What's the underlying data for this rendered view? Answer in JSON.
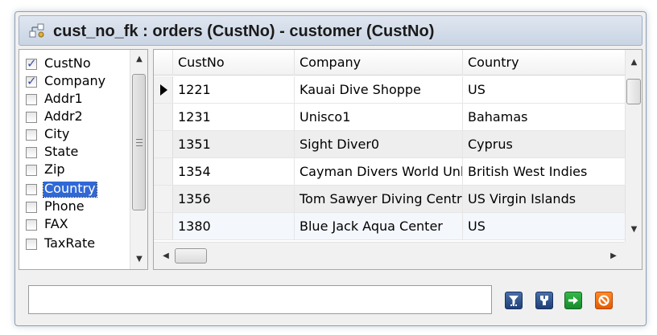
{
  "window": {
    "title": "cust_no_fk : orders (CustNo) - customer (CustNo)"
  },
  "fields": [
    {
      "label": "CustNo",
      "checked": true,
      "selected": false
    },
    {
      "label": "Company",
      "checked": true,
      "selected": false
    },
    {
      "label": "Addr1",
      "checked": false,
      "selected": false
    },
    {
      "label": "Addr2",
      "checked": false,
      "selected": false
    },
    {
      "label": "City",
      "checked": false,
      "selected": false
    },
    {
      "label": "State",
      "checked": false,
      "selected": false
    },
    {
      "label": "Zip",
      "checked": false,
      "selected": false
    },
    {
      "label": "Country",
      "checked": false,
      "selected": true
    },
    {
      "label": "Phone",
      "checked": false,
      "selected": false
    },
    {
      "label": "FAX",
      "checked": false,
      "selected": false
    },
    {
      "label": "TaxRate",
      "checked": false,
      "selected": false
    }
  ],
  "grid": {
    "columns": [
      "CustNo",
      "Company",
      "Country"
    ],
    "rows": [
      {
        "CustNo": "1221",
        "Company": "Kauai Dive Shoppe",
        "Country": "US",
        "current": true
      },
      {
        "CustNo": "1231",
        "Company": "Unisco1",
        "Country": "Bahamas",
        "current": false
      },
      {
        "CustNo": "1351",
        "Company": "Sight Diver0",
        "Country": "Cyprus",
        "current": false
      },
      {
        "CustNo": "1354",
        "Company": "Cayman Divers World Unlimited",
        "Country": "British West Indies",
        "current": false
      },
      {
        "CustNo": "1356",
        "Company": "Tom Sawyer Diving Centre",
        "Country": "US Virgin Islands",
        "current": false
      },
      {
        "CustNo": "1380",
        "Company": "Blue Jack Aqua Center",
        "Country": "US",
        "current": false
      }
    ]
  },
  "filter": {
    "value": "",
    "placeholder": ""
  },
  "toolbar": {
    "filter_icon": "filter-icon",
    "edit_icon": "edit-icon",
    "ok_icon": "arrow-right-icon",
    "cancel_icon": "cancel-icon"
  },
  "colors": {
    "selection": "#3068d6",
    "title_bg": "#c9d4e3",
    "ok_green": "#178a2c",
    "cancel_orange": "#e45b00",
    "tool_blue": "#1f3f77"
  }
}
